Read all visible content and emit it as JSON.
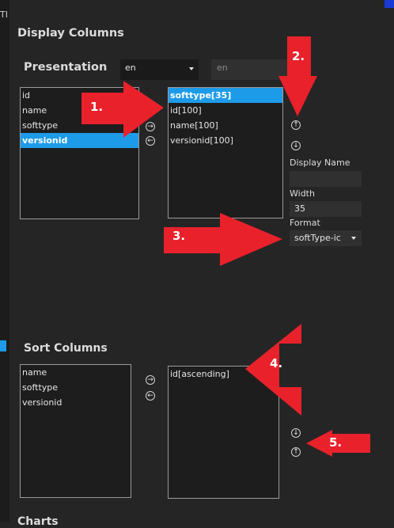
{
  "window": {
    "edge_char": "TI"
  },
  "display_columns": {
    "title": "Display Columns",
    "presentation": {
      "title": "Presentation",
      "language_select": "en",
      "language_text_placeholder": "en",
      "available_columns": [
        {
          "label": "id",
          "selected": false
        },
        {
          "label": "name",
          "selected": false
        },
        {
          "label": "softtype",
          "selected": false
        },
        {
          "label": "versionid",
          "selected": true
        }
      ],
      "selected_columns": [
        {
          "label": "softtype[35]",
          "selected": true
        },
        {
          "label": "id[100]",
          "selected": false
        },
        {
          "label": "name[100]",
          "selected": false
        },
        {
          "label": "versionid[100]",
          "selected": false
        }
      ],
      "add_button": "→",
      "remove_button": "←",
      "move_up_button": "↑",
      "move_down_button": "↓",
      "display_name_label": "Display Name",
      "display_name_value": "",
      "width_label": "Width",
      "width_value": "35",
      "format_label": "Format",
      "format_value": "softType-ic"
    }
  },
  "sort_columns": {
    "title": "Sort Columns",
    "available_columns": [
      "name",
      "softtype",
      "versionid"
    ],
    "selected_columns": [
      "id[ascending]"
    ],
    "add_button": "→",
    "remove_button": "←",
    "sort_desc_button": "↓",
    "sort_asc_button": "↑"
  },
  "charts": {
    "title": "Charts"
  },
  "annotations": [
    "1.",
    "2.",
    "3.",
    "4.",
    "5."
  ],
  "colors": {
    "accent": "#1e9be8",
    "callout": "#e8212b",
    "background": "#252525"
  }
}
